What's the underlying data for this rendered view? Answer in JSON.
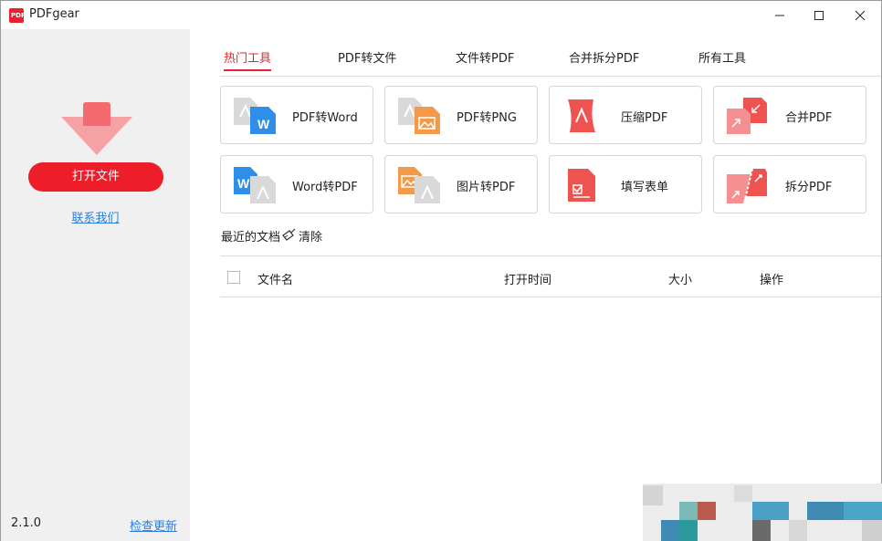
{
  "window": {
    "title": "PDFgear",
    "logo_text": "PDF"
  },
  "sidebar": {
    "open_button": "打开文件",
    "contact_link": "联系我们",
    "version": "2.1.0",
    "update_link": "检查更新"
  },
  "tabs": [
    {
      "label": "热门工具",
      "active": true
    },
    {
      "label": "PDF转文件",
      "active": false
    },
    {
      "label": "文件转PDF",
      "active": false
    },
    {
      "label": "合并拆分PDF",
      "active": false
    },
    {
      "label": "所有工具",
      "active": false
    }
  ],
  "tools": [
    {
      "label": "PDF转Word",
      "icon": "pdf-to-word-icon"
    },
    {
      "label": "PDF转PNG",
      "icon": "pdf-to-png-icon"
    },
    {
      "label": "压缩PDF",
      "icon": "compress-pdf-icon"
    },
    {
      "label": "合并PDF",
      "icon": "merge-pdf-icon"
    },
    {
      "label": "Word转PDF",
      "icon": "word-to-pdf-icon"
    },
    {
      "label": "图片转PDF",
      "icon": "image-to-pdf-icon"
    },
    {
      "label": "填写表单",
      "icon": "fill-form-icon"
    },
    {
      "label": "拆分PDF",
      "icon": "split-pdf-icon"
    }
  ],
  "recent": {
    "title": "最近的文档",
    "clear_label": "清除",
    "columns": [
      "文件名",
      "打开时间",
      "大小",
      "操作"
    ],
    "rows": []
  },
  "colors": {
    "accent": "#e8202f",
    "link": "#2f7ed8",
    "word_blue": "#2f8fe8",
    "image_orange": "#f39a4a",
    "pdf_red": "#ef5350",
    "sidebar_bg": "#f0f0f0"
  }
}
